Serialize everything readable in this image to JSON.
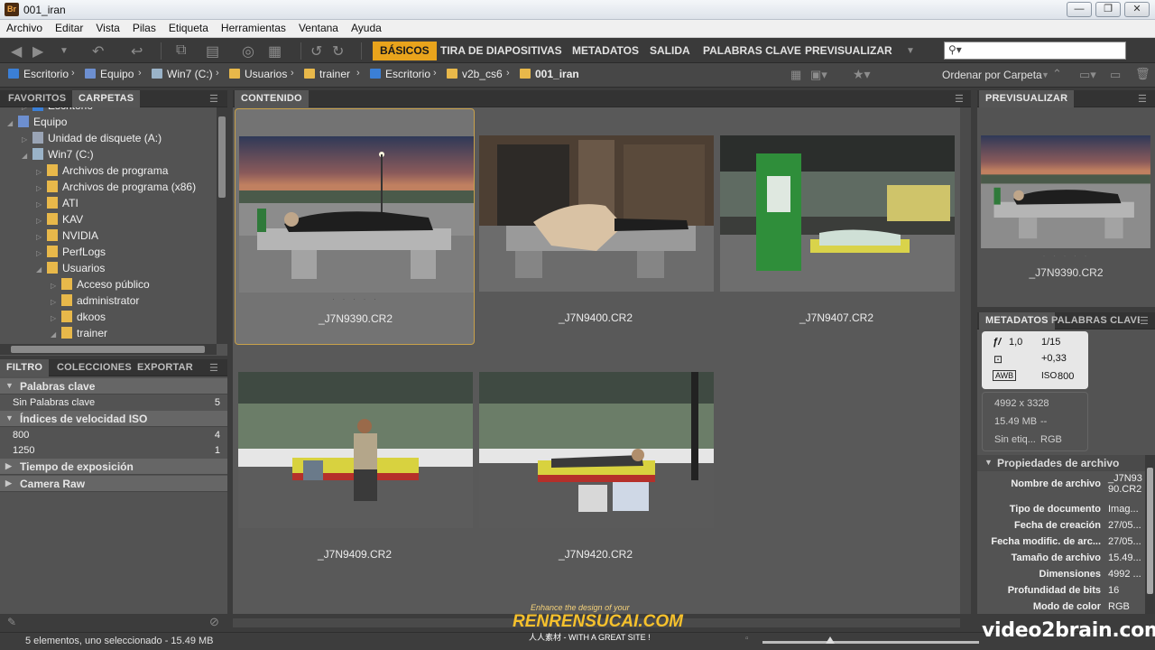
{
  "window": {
    "title": "001_iran",
    "app_badge": "Br"
  },
  "menu": [
    "Archivo",
    "Editar",
    "Vista",
    "Pilas",
    "Etiqueta",
    "Herramientas",
    "Ventana",
    "Ayuda"
  ],
  "workspaces": [
    "BÁSICOS",
    "TIRA DE DIAPOSITIVAS",
    "METADATOS",
    "SALIDA",
    "PALABRAS CLAVE",
    "PREVISUALIZAR"
  ],
  "active_workspace": "BÁSICOS",
  "search": {
    "placeholder": ""
  },
  "breadcrumb": [
    "Escritorio",
    "Equipo",
    "Win7 (C:)",
    "Usuarios",
    "trainer",
    "Escritorio",
    "v2b_cs6",
    "001_iran"
  ],
  "sort_label": "Ordenar por Carpeta",
  "left_top": {
    "tabs": [
      "FAVORITOS",
      "CARPETAS"
    ],
    "tree": [
      {
        "label": "Escritorio",
        "indent": 1,
        "icon": "desktop-icon"
      },
      {
        "label": "Equipo",
        "indent": 0,
        "icon": "computer-icon"
      },
      {
        "label": "Unidad de disquete (A:)",
        "indent": 1,
        "icon": "floppy-icon"
      },
      {
        "label": "Win7 (C:)",
        "indent": 1,
        "icon": "drive-icon"
      },
      {
        "label": "Archivos de programa",
        "indent": 2,
        "icon": "folder-icon"
      },
      {
        "label": "Archivos de programa (x86)",
        "indent": 2,
        "icon": "folder-icon"
      },
      {
        "label": "ATI",
        "indent": 2,
        "icon": "folder-icon"
      },
      {
        "label": "KAV",
        "indent": 2,
        "icon": "folder-icon"
      },
      {
        "label": "NVIDIA",
        "indent": 2,
        "icon": "folder-icon"
      },
      {
        "label": "PerfLogs",
        "indent": 2,
        "icon": "folder-icon"
      },
      {
        "label": "Usuarios",
        "indent": 2,
        "icon": "folder-icon"
      },
      {
        "label": "Acceso público",
        "indent": 3,
        "icon": "folder-icon"
      },
      {
        "label": "administrator",
        "indent": 3,
        "icon": "folder-icon"
      },
      {
        "label": "dkoos",
        "indent": 3,
        "icon": "folder-icon"
      },
      {
        "label": "trainer",
        "indent": 3,
        "icon": "folder-icon"
      }
    ]
  },
  "left_bottom": {
    "tabs": [
      "FILTRO",
      "COLECCIONES",
      "EXPORTAR"
    ],
    "groups": [
      {
        "title": "Palabras clave",
        "open": true,
        "rows": [
          {
            "label": "Sin Palabras clave",
            "count": "5"
          }
        ]
      },
      {
        "title": "Índices de velocidad ISO",
        "open": true,
        "rows": [
          {
            "label": "800",
            "count": "4"
          },
          {
            "label": "1250",
            "count": "1"
          }
        ]
      },
      {
        "title": "Tiempo de exposición",
        "open": false,
        "rows": []
      },
      {
        "title": "Camera Raw",
        "open": false,
        "rows": []
      }
    ]
  },
  "content": {
    "tab": "CONTENIDO",
    "items": [
      {
        "name": "_J7N9390.CR2",
        "selected": true,
        "scene": "bench-sunset"
      },
      {
        "name": "_J7N9400.CR2",
        "selected": false,
        "scene": "bench-blanket"
      },
      {
        "name": "_J7N9407.CR2",
        "selected": false,
        "scene": "booth"
      },
      {
        "name": "_J7N9409.CR2",
        "selected": false,
        "scene": "man-seated"
      },
      {
        "name": "_J7N9420.CR2",
        "selected": false,
        "scene": "man-lying"
      }
    ],
    "rating_dots": "· · · · ·"
  },
  "preview": {
    "tab": "PREVISUALIZAR",
    "filename": "_J7N9390.CR2",
    "rating_dots": "· · · · ·"
  },
  "metadata": {
    "tabs": [
      "METADATOS",
      "PALABRAS CLAVE"
    ],
    "placard": {
      "aperture": "1,0",
      "shutter": "1/15",
      "ev": "+0,33",
      "wb": "AWB",
      "iso_label": "ISO",
      "iso": "800"
    },
    "info": {
      "dimensions": "4992 x 3328",
      "size": "15.49 MB",
      "dash": "--",
      "label": "Sin etiq...",
      "mode": "RGB"
    },
    "props_title": "Propiedades de archivo",
    "props": [
      {
        "label": "Nombre de archivo",
        "value": "_J7N93\n90.CR2"
      },
      {
        "label": "Tipo de documento",
        "value": "Imag..."
      },
      {
        "label": "Fecha de creación",
        "value": "27/05..."
      },
      {
        "label": "Fecha modific. de arc...",
        "value": "27/05..."
      },
      {
        "label": "Tamaño de archivo",
        "value": "15.49..."
      },
      {
        "label": "Dimensiones",
        "value": "4992 ..."
      },
      {
        "label": "Profundidad de bits",
        "value": "16"
      },
      {
        "label": "Modo de color",
        "value": "RGB"
      }
    ]
  },
  "status": {
    "text": "5 elementos, uno seleccionado - 15.49 MB",
    "zoom": 0.3
  },
  "branding": {
    "logo": "video2brain.com",
    "watermark_top": "Enhance the design of your",
    "watermark_main": "RENRENSUCAI.COM",
    "watermark_bottom": "人人素材 - WITH A GREAT SITE !"
  },
  "colors": {
    "accent": "#e9a41c",
    "panel": "#535353",
    "content": "#595959",
    "folder": "#e8b84a"
  }
}
